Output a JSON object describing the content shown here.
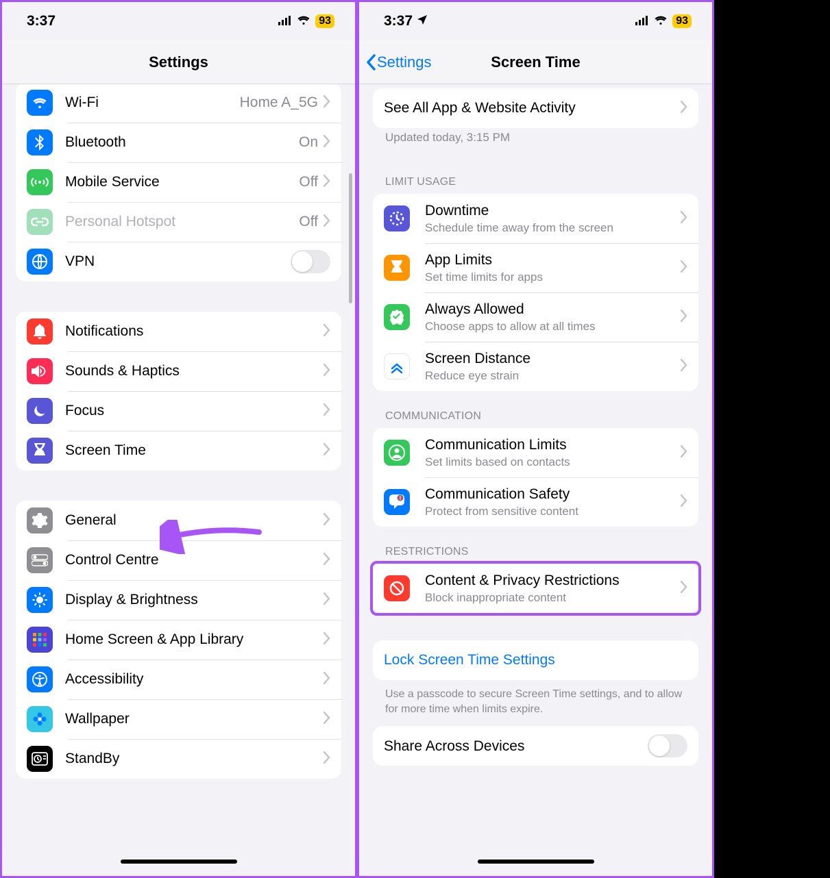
{
  "status": {
    "time": "3:37",
    "battery": "93"
  },
  "left": {
    "title": "Settings",
    "rows": {
      "wifi": {
        "label": "Wi-Fi",
        "value": "Home A_5G",
        "icon": "wifi",
        "color": "#007aff"
      },
      "bt": {
        "label": "Bluetooth",
        "value": "On",
        "icon": "bluetooth",
        "color": "#007aff"
      },
      "mobile": {
        "label": "Mobile Service",
        "value": "Off",
        "icon": "antenna",
        "color": "#34c759"
      },
      "hotspot": {
        "label": "Personal Hotspot",
        "value": "Off",
        "icon": "link",
        "color": "#9fe0b9"
      },
      "vpn": {
        "label": "VPN",
        "icon": "globe",
        "color": "#007aff"
      },
      "notif": {
        "label": "Notifications",
        "icon": "bell",
        "color": "#ff3b30"
      },
      "sounds": {
        "label": "Sounds & Haptics",
        "icon": "speaker",
        "color": "#ff2d55"
      },
      "focus": {
        "label": "Focus",
        "icon": "moon",
        "color": "#5856d6"
      },
      "screentime": {
        "label": "Screen Time",
        "icon": "hourglass",
        "color": "#5856d6"
      },
      "general": {
        "label": "General",
        "icon": "gear",
        "color": "#8e8e93"
      },
      "control": {
        "label": "Control Centre",
        "icon": "switches",
        "color": "#8e8e93"
      },
      "display": {
        "label": "Display & Brightness",
        "icon": "sun",
        "color": "#007aff"
      },
      "home": {
        "label": "Home Screen & App Library",
        "icon": "grid",
        "color": "#4a45d6"
      },
      "access": {
        "label": "Accessibility",
        "icon": "person",
        "color": "#007aff"
      },
      "wallpaper": {
        "label": "Wallpaper",
        "icon": "flower",
        "color": "#34c7e6"
      },
      "standby": {
        "label": "StandBy",
        "icon": "clock",
        "color": "#000000"
      }
    }
  },
  "right": {
    "back": "Settings",
    "title": "Screen Time",
    "seeall": "See All App & Website Activity",
    "updated": "Updated today, 3:15 PM",
    "sections": {
      "limit": {
        "header": "LIMIT USAGE",
        "downtime": {
          "label": "Downtime",
          "sub": "Schedule time away from the screen",
          "color": "#5856d6"
        },
        "applimits": {
          "label": "App Limits",
          "sub": "Set time limits for apps",
          "color": "#ff9500"
        },
        "always": {
          "label": "Always Allowed",
          "sub": "Choose apps to allow at all times",
          "color": "#34c759"
        },
        "distance": {
          "label": "Screen Distance",
          "sub": "Reduce eye strain",
          "color": "#ffffff"
        }
      },
      "comm": {
        "header": "COMMUNICATION",
        "limits": {
          "label": "Communication Limits",
          "sub": "Set limits based on contacts",
          "color": "#34c759"
        },
        "safety": {
          "label": "Communication Safety",
          "sub": "Protect from sensitive content",
          "color": "#007aff"
        }
      },
      "restrict": {
        "header": "RESTRICTIONS",
        "content": {
          "label": "Content & Privacy Restrictions",
          "sub": "Block inappropriate content",
          "color": "#ff3b30"
        }
      }
    },
    "lock": "Lock Screen Time Settings",
    "locknote": "Use a passcode to secure Screen Time settings, and to allow for more time when limits expire.",
    "share": "Share Across Devices"
  }
}
